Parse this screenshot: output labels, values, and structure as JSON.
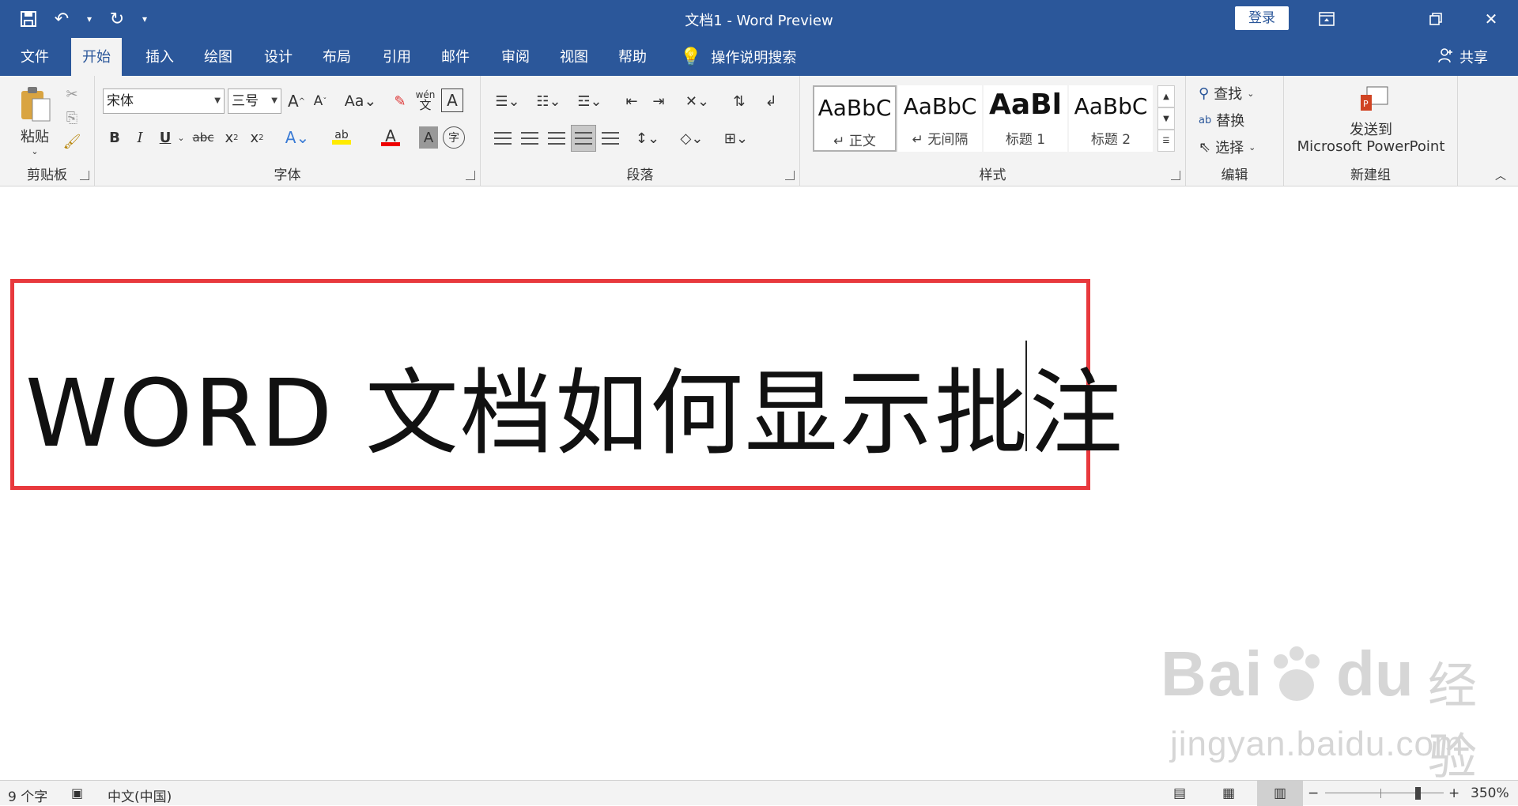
{
  "window": {
    "title": "文档1  -  Word Preview",
    "login": "登录"
  },
  "tabs": [
    "文件",
    "开始",
    "插入",
    "绘图",
    "设计",
    "布局",
    "引用",
    "邮件",
    "审阅",
    "视图",
    "帮助"
  ],
  "tell_me": "操作说明搜索",
  "share": "共享",
  "clipboard": {
    "paste": "粘贴",
    "label": "剪贴板"
  },
  "font": {
    "name": "宋体",
    "size": "三号",
    "label": "字体"
  },
  "paragraph": {
    "label": "段落"
  },
  "styles": {
    "label": "样式",
    "items": [
      {
        "sample": "AaBbC",
        "name": "↵ 正文"
      },
      {
        "sample": "AaBbC",
        "name": "↵ 无间隔"
      },
      {
        "sample": "AaBl",
        "name": "标题 1"
      },
      {
        "sample": "AaBbC",
        "name": "标题 2"
      }
    ]
  },
  "editing": {
    "find": "查找",
    "replace": "替换",
    "select": "选择",
    "label": "编辑"
  },
  "newgroup": {
    "line1": "发送到",
    "line2": "Microsoft PowerPoint",
    "label": "新建组"
  },
  "document": {
    "text": "WORD 文档如何显示批注"
  },
  "status": {
    "words": "9 个字",
    "language": "中文(中国)",
    "zoom": "350%"
  },
  "watermark": {
    "brand": "Bai",
    "brand2": "经验",
    "url": "jingyan.baidu.com"
  }
}
